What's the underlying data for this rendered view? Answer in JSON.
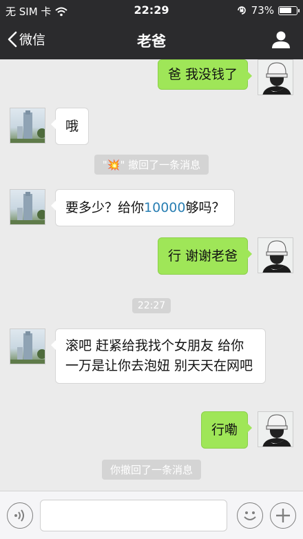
{
  "status_bar": {
    "carrier": "无 SIM 卡",
    "time": "22:29",
    "battery": "73%",
    "battery_level": 0.73
  },
  "nav": {
    "back_label": "微信",
    "title": "老爸"
  },
  "messages": [
    {
      "text": "爸 我没钱了"
    },
    {
      "text": "哦"
    },
    {
      "prefix": "\"",
      "suffix": "\" 撤回了一条消息"
    },
    {
      "text_before": "要多少？给你",
      "highlight": "10000",
      "text_after": "够吗？"
    },
    {
      "text": "行 谢谢老爸"
    },
    {
      "text": "22:27"
    },
    {
      "text": "滚吧 赶紧给我找个女朋友 给你一万是让你去泡妞 别天天在网吧"
    },
    {
      "text": "行嘞"
    },
    {
      "text": "你撤回了一条消息"
    }
  ],
  "colors": {
    "header": "#2b2b2d",
    "chat_bg": "#ebebeb",
    "my_bubble": "#9fe658",
    "their_bubble": "#ffffff",
    "highlight": "#2a7fb3"
  },
  "icons": {
    "back": "chevron-left-icon",
    "profile": "person-icon",
    "voice": "voice-icon",
    "emoji": "smiley-icon",
    "add": "plus-icon",
    "explosion": "explosion-emoji-icon"
  }
}
